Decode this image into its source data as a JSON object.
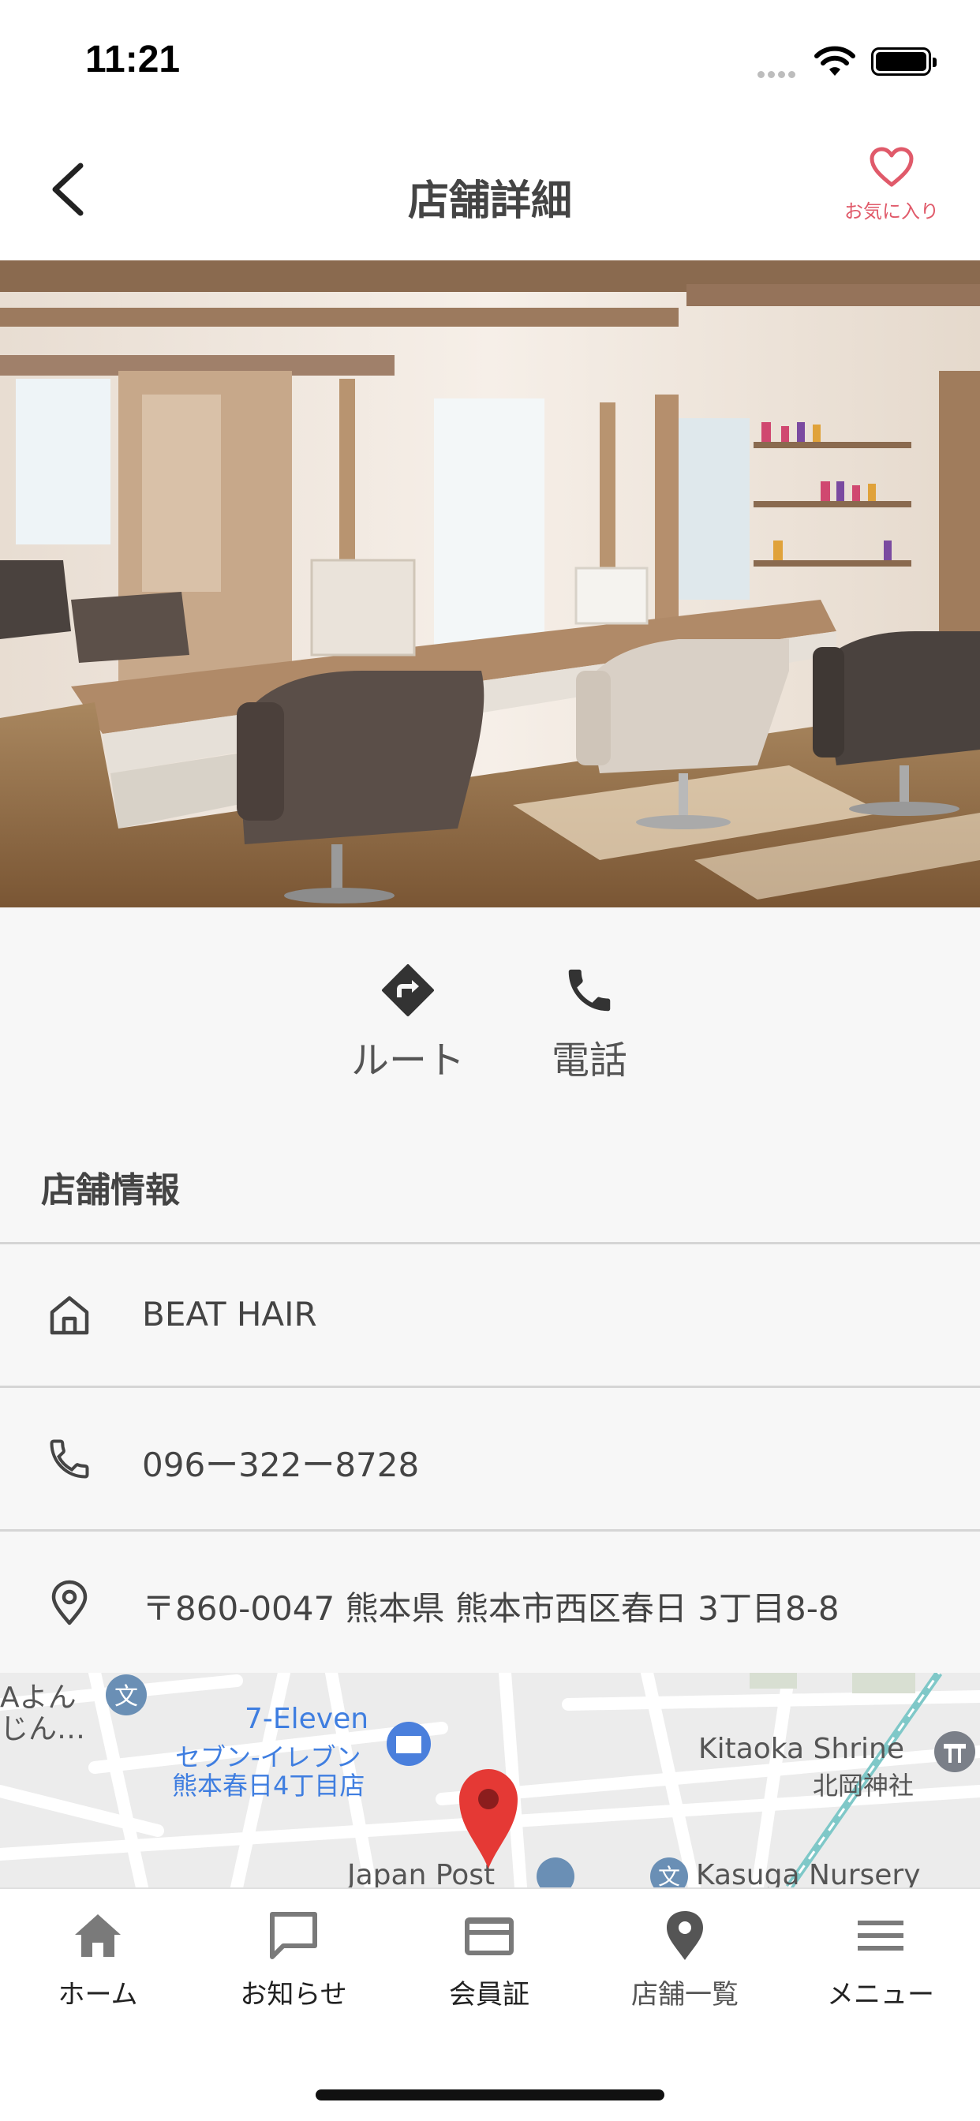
{
  "status_bar": {
    "time": "11:21"
  },
  "header": {
    "title": "店舗詳細",
    "favorite_label": "お気に入り"
  },
  "actions": {
    "route_label": "ルート",
    "phone_label": "電話"
  },
  "store_info": {
    "section_title": "店舗情報",
    "name": "BEAT HAIR",
    "phone": "096ー322ー8728",
    "address": "〒860-0047 熊本県 熊本市西区春日 3丁目8-8"
  },
  "map": {
    "labels": {
      "label_a_line1": "Aよん",
      "label_a_line2": "じん…",
      "seven_eleven_en": "7-Eleven",
      "seven_eleven_ja1": "セブン-イレブン",
      "seven_eleven_ja2": "熊本春日4丁目店",
      "kitaoka_en": "Kitaoka Shrine",
      "kitaoka_ja": "北岡神社",
      "japan_post": "Japan Post",
      "kasuga_nursery": "Kasuga Nursery"
    }
  },
  "tabs": [
    {
      "label": "ホーム",
      "icon": "home-icon"
    },
    {
      "label": "お知らせ",
      "icon": "chat-icon"
    },
    {
      "label": "会員証",
      "icon": "card-icon"
    },
    {
      "label": "店舗一覧",
      "icon": "location-icon"
    },
    {
      "label": "メニュー",
      "icon": "menu-icon"
    }
  ],
  "colors": {
    "accent_favorite": "#e05a6a",
    "map_pin": "#e53935",
    "tab_icon": "#7a7a7a",
    "map_blue": "#3f7ee0"
  }
}
